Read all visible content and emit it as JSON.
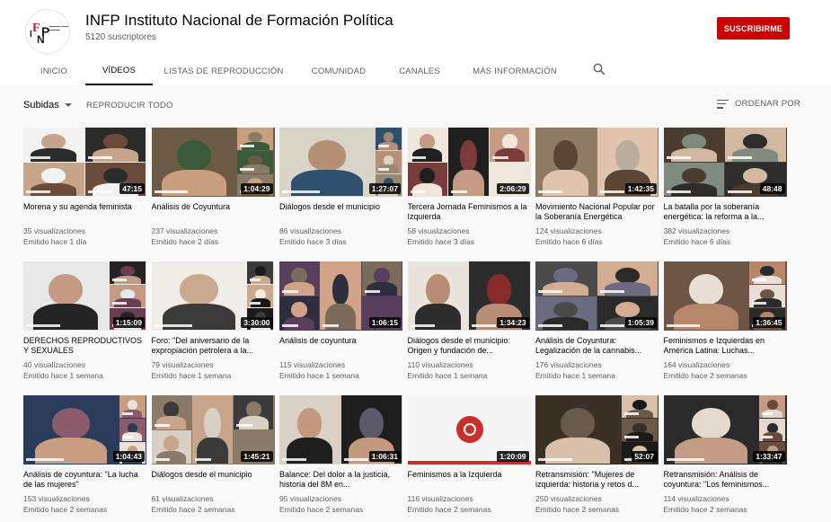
{
  "channel": {
    "name": "INFP Instituto Nacional de Formación Política",
    "subscribers": "5120 suscriptores",
    "subscribe_label": "SUSCRIBIRME",
    "logo_letters": [
      "F",
      "I",
      "N",
      "P"
    ],
    "brand_color": "#cc0000"
  },
  "tabs": [
    {
      "label": "INICIO",
      "active": false
    },
    {
      "label": "VÍDEOS",
      "active": true
    },
    {
      "label": "LISTAS DE REPRODUCCIÓN",
      "active": false
    },
    {
      "label": "COMUNIDAD",
      "active": false
    },
    {
      "label": "CANALES",
      "active": false
    },
    {
      "label": "MÁS INFORMACIÓN",
      "active": false
    }
  ],
  "toolbar": {
    "sort_label": "Subidas",
    "play_all_label": "REPRODUCIR TODO",
    "order_by_label": "ORDENAR POR"
  },
  "icons": {
    "search": "search-icon",
    "sort": "sort-lines-icon",
    "dropdown": "chevron-down-icon"
  },
  "videos": [
    {
      "title": "Morena y su agenda feminista",
      "duration": "47:15",
      "views": "35 visualizaciones",
      "date": "Emitido hace 1 día",
      "palette": [
        "#f2f2f2",
        "#2b2b2b",
        "#c7a58a",
        "#6b4c3b"
      ]
    },
    {
      "title": "Análisis de Coyuntura",
      "duration": "1:04:29",
      "views": "237 visualizaciones",
      "date": "Emitido hace 2 días",
      "palette": [
        "#6b5a45",
        "#c99f7f",
        "#3a5a3a",
        "#8a7b66"
      ]
    },
    {
      "title": "Diálogos desde el municipio",
      "duration": "1:27:07",
      "views": "86 visualizaciones",
      "date": "Emitido hace 3 días",
      "palette": [
        "#d8d4c8",
        "#2f4f6f",
        "#b58f76",
        "#9a8872"
      ]
    },
    {
      "title": "Tercera Jornada Feminismos a la Izquierda",
      "duration": "2:06:29",
      "views": "58 visualizaciones",
      "date": "Emitido hace 3 días",
      "palette": [
        "#efe6dc",
        "#1f1f1f",
        "#c79a84",
        "#7a3b3b"
      ]
    },
    {
      "title": "Movimiento Nacional Popular por la Soberanía Energética",
      "duration": "1:42:35",
      "views": "124 visualizaciones",
      "date": "Emitido hace 6 días",
      "palette": [
        "#8f7a63",
        "#e0c4ad",
        "#5b4636",
        "#b9ada0"
      ]
    },
    {
      "title": "La batalla por la soberanía energética: la reforma a la...",
      "duration": "48:48",
      "views": "382 visualizaciones",
      "date": "Emitido hace 6 días",
      "palette": [
        "#4a3c2e",
        "#d2b8a0",
        "#7f8b7e",
        "#2d2d2d"
      ]
    },
    {
      "title": "DERECHOS REPRODUCTIVOS Y SEXUALES",
      "duration": "1:15:09",
      "views": "40 visualizaciones",
      "date": "Emitido hace 1 semana",
      "palette": [
        "#e8e8e8",
        "#242424",
        "#c49a85",
        "#6a3d52"
      ]
    },
    {
      "title": "Foro: \"Del aniversario de la expropiación petrolera a la...",
      "duration": "3:30:00",
      "views": "79 visualizaciones",
      "date": "Emitido hace 1 semana",
      "palette": [
        "#f0ede8",
        "#3a3a3a",
        "#c9a98f",
        "#1a1a1a"
      ]
    },
    {
      "title": "Análisis de coyuntura",
      "duration": "1:06:15",
      "views": "115 visualizaciones",
      "date": "Emitido hace 1 semana",
      "palette": [
        "#5a3e5e",
        "#d1a48a",
        "#7b6b5a",
        "#2e2e3e"
      ]
    },
    {
      "title": "Diálogos desde el municipio: Origen y fundación de...",
      "duration": "1:34:23",
      "views": "110 visualizaciones",
      "date": "Emitido hace 1 semana",
      "palette": [
        "#e9e4dc",
        "#2c2c2c",
        "#b88f74",
        "#8a2b2b"
      ]
    },
    {
      "title": "Análisis de Coyuntura: Legalización de la cannabis...",
      "duration": "1:05:39",
      "views": "176 visualizaciones",
      "date": "Emitido hace 1 semana",
      "palette": [
        "#4b4b4b",
        "#d2ad92",
        "#6a6a80",
        "#2a2a2a"
      ]
    },
    {
      "title": "Feminismos e Izquierdas en América Latina: Luchas...",
      "duration": "1:36:45",
      "views": "164 visualizaciones",
      "date": "Emitido hace 2 semanas",
      "palette": [
        "#6e5545",
        "#b7876c",
        "#e9dfd6",
        "#2b2b2b"
      ]
    },
    {
      "title": "Análisis de coyuntura: \"La lucha de las mujeres\"",
      "duration": "1:04:43",
      "views": "153 visualizaciones",
      "date": "Emitido hace 2 semanas",
      "palette": [
        "#2b3b5a",
        "#c89d82",
        "#8a5b6b",
        "#e8e2da"
      ]
    },
    {
      "title": "Diálogos desde el municipio",
      "duration": "1:45:21",
      "views": "61 visualizaciones",
      "date": "Emitido hace 2 semanas",
      "palette": [
        "#8a7a6a",
        "#c9a58c",
        "#3a3a3a",
        "#d9d0c4"
      ]
    },
    {
      "title": "Balance: Del dolor a la justicia, historia del 8M en...",
      "duration": "1:06:31",
      "views": "95 visualizaciones",
      "date": "Emitido hace 2 semanas",
      "palette": [
        "#d9d1c6",
        "#1e1e1e",
        "#c39a80",
        "#5a5a6a"
      ]
    },
    {
      "title": "Feminismos a la Izquierda",
      "duration": "1:20:09",
      "views": "116 visualizaciones",
      "date": "Emitido hace 2 semanas",
      "palette": [
        "#f5f5f5",
        "#f5f5f5",
        "#f5f5f5",
        "#f5f5f5"
      ],
      "logo": true
    },
    {
      "title": "Retransmisión: \"Mujeres de izquierda: historia y retos d...",
      "duration": "52:07",
      "views": "250 visualizaciones",
      "date": "Emitido hace 2 semanas",
      "palette": [
        "#3a3026",
        "#d8c0ab",
        "#6a5a4a",
        "#1a1a1a"
      ]
    },
    {
      "title": "Retransmisión: Análisis de coyuntura: \"Los feminismos...",
      "duration": "1:33:47",
      "views": "114 visualizaciones",
      "date": "Emitido hace 2 semanas",
      "palette": [
        "#2a2a2a",
        "#c49c86",
        "#e4d9cf",
        "#6a4a3a"
      ]
    }
  ]
}
